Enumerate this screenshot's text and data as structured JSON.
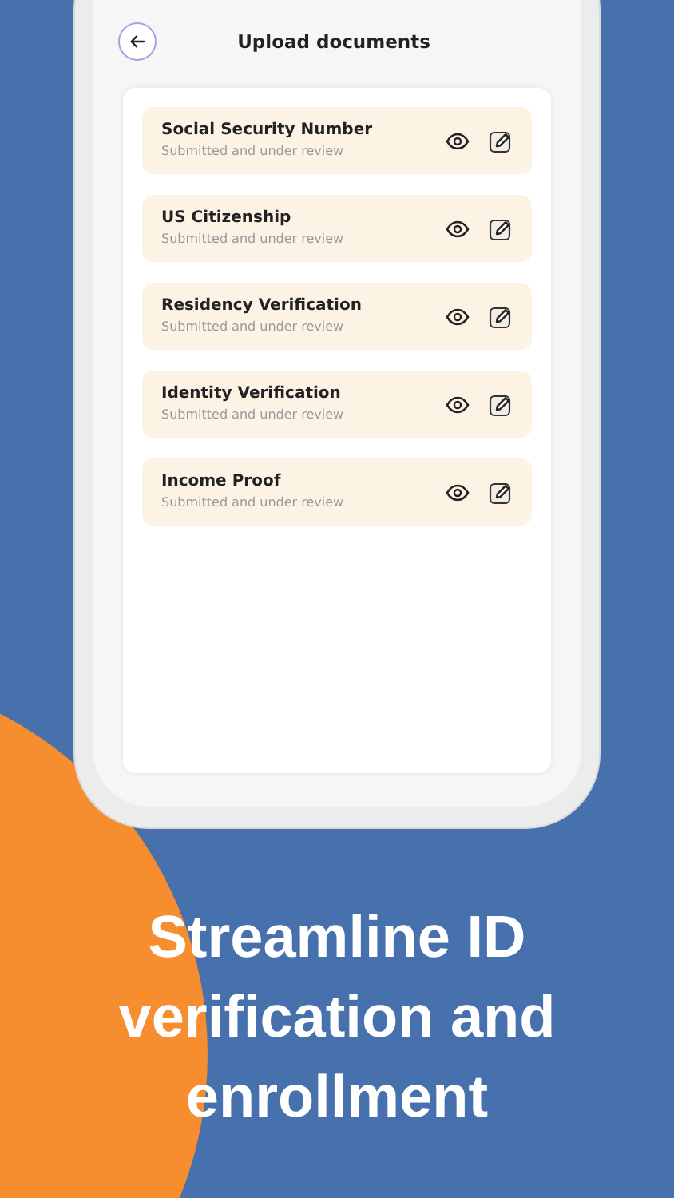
{
  "screen": {
    "title": "Upload documents"
  },
  "documents": [
    {
      "title": "Social Security Number",
      "status": "Submitted and under review"
    },
    {
      "title": "US Citizenship",
      "status": "Submitted and under review"
    },
    {
      "title": "Residency Verification",
      "status": "Submitted and under review"
    },
    {
      "title": "Identity Verification",
      "status": "Submitted and under review"
    },
    {
      "title": "Income Proof",
      "status": "Submitted and under review"
    }
  ],
  "headline": "Streamline ID verification and enrollment"
}
